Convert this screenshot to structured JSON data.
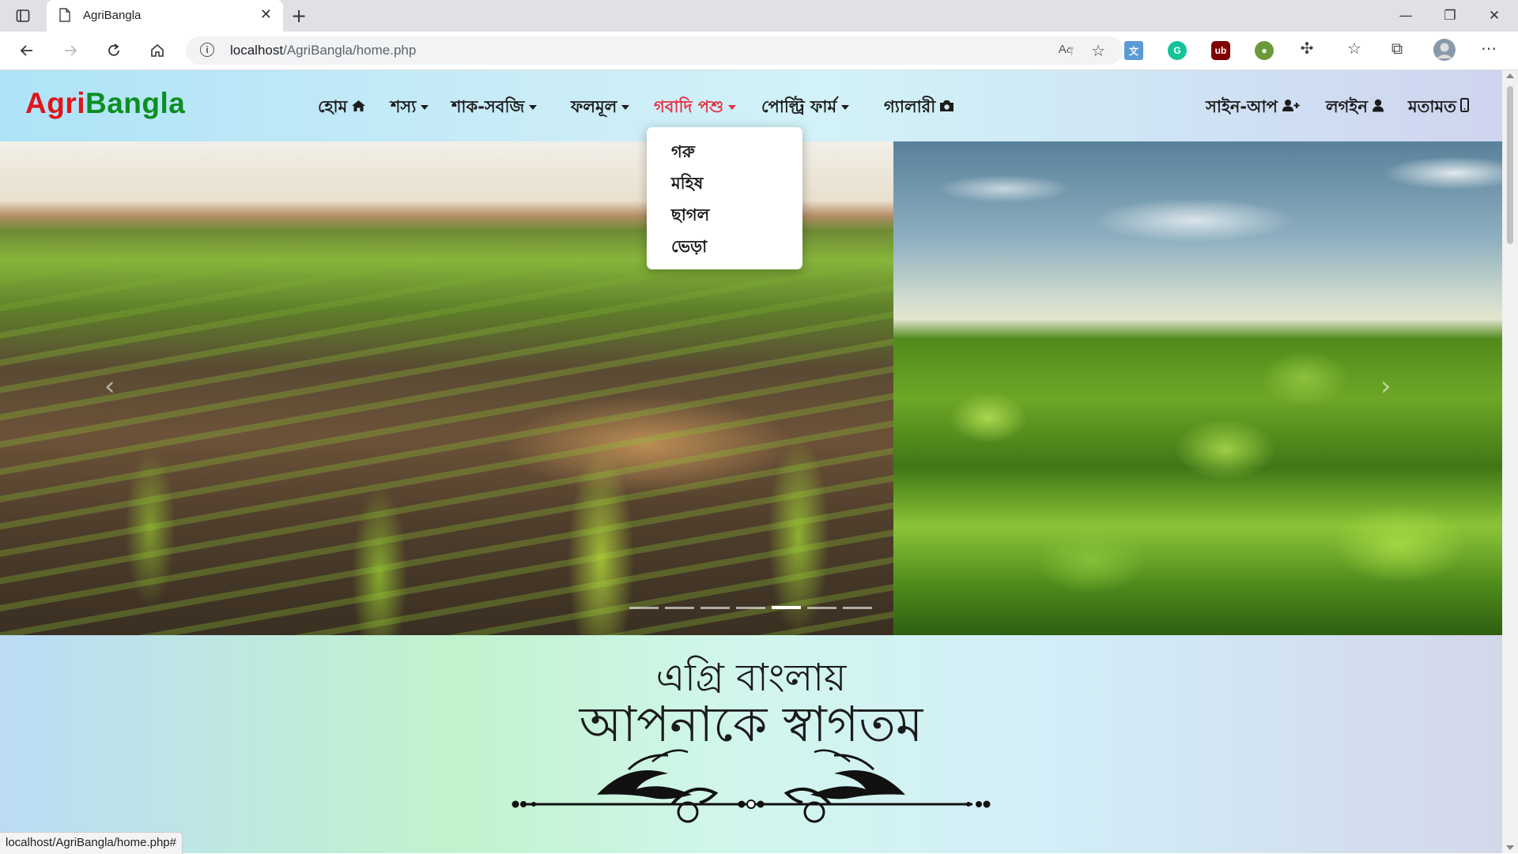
{
  "browser": {
    "tab_title": "AgriBangla",
    "new_tab_symbol": "+",
    "tab_close_symbol": "✕",
    "url_host": "localhost",
    "url_path": "/AgriBangla/home.php",
    "read_aloud_label": "Aඅ",
    "window_controls": {
      "minimize": "—",
      "restore": "❐",
      "close": "✕"
    },
    "extensions": [
      {
        "name": "translate-extension",
        "label": "文",
        "color": "#5b9bd5"
      },
      {
        "name": "grammarly-extension",
        "label": "G",
        "color": "#15c39a"
      },
      {
        "name": "ublock-extension",
        "label": "ub",
        "color": "#800000"
      },
      {
        "name": "globe-extension",
        "label": "●",
        "color": "#6a9a3a"
      }
    ],
    "status_url": "localhost/AgriBangla/home.php#"
  },
  "navbar": {
    "brand_part1": "Agri",
    "brand_part2": "Bangla",
    "brand_colors": {
      "part1": "#e1141b",
      "part2": "#0c8e22"
    },
    "items": [
      {
        "label": "হোম",
        "icon": "home-icon",
        "dropdown": false
      },
      {
        "label": "শস্য",
        "dropdown": true
      },
      {
        "label": "শাক-সবজি",
        "dropdown": true
      },
      {
        "label": "ফলমূল",
        "dropdown": true
      },
      {
        "label": "গবাদি পশু",
        "dropdown": true,
        "active": true
      },
      {
        "label": "পোল্ট্রি ফার্ম",
        "dropdown": true
      },
      {
        "label": "গ্যালারী",
        "icon": "camera-icon",
        "dropdown": false
      }
    ],
    "right_items": [
      {
        "label": "সাইন-আপ",
        "icon": "user-plus-icon"
      },
      {
        "label": "লগইন",
        "icon": "user-icon"
      },
      {
        "label": "মতামত",
        "icon": "mobile-icon"
      }
    ],
    "active_color": "#e83347"
  },
  "dropdown": {
    "items": [
      "গরু",
      "মহিষ",
      "ছাগল",
      "ভেড়া"
    ]
  },
  "carousel": {
    "prev_symbol": "‹",
    "next_symbol": "›",
    "indicator_count": 7,
    "active_indicator": 5
  },
  "welcome": {
    "line1": "এগ্রি বাংলায়",
    "line2": "আপনাকে স্বাগতম"
  }
}
